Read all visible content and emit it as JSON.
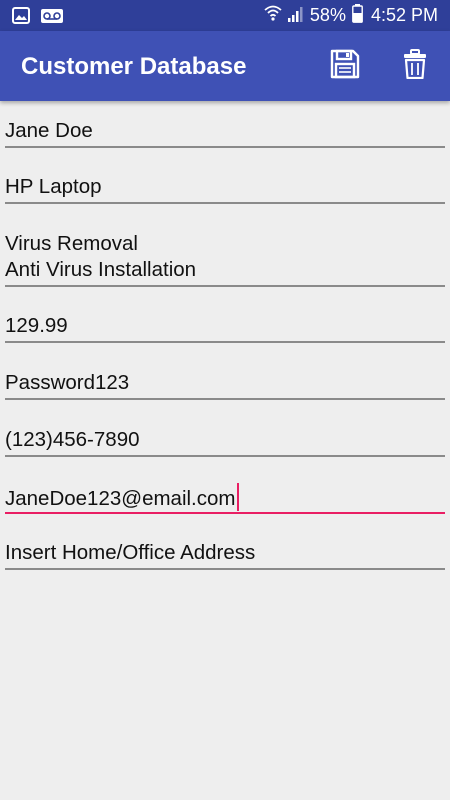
{
  "status_bar": {
    "battery": "58%",
    "time": "4:52 PM",
    "icons": [
      "image-icon",
      "voicemail-icon",
      "wifi-icon",
      "signal-icon",
      "battery-icon"
    ]
  },
  "app_bar": {
    "title": "Customer Database",
    "actions": [
      "save-icon",
      "delete-icon"
    ]
  },
  "form": {
    "name": "Jane Doe",
    "device": "HP Laptop",
    "service_line1": "Virus Removal",
    "service_line2": "Anti Virus Installation",
    "price": "129.99",
    "password": "Password123",
    "phone": "(123)456-7890",
    "email": "JaneDoe123@email.com",
    "address_placeholder": "Insert Home/Office Address"
  },
  "colors": {
    "status_bar": "#2f3f99",
    "app_bar": "#3f51b5",
    "accent": "#e91e63",
    "background": "#eeeeee"
  }
}
